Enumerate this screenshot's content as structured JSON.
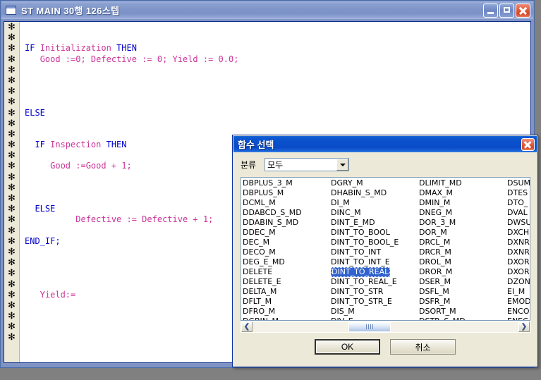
{
  "editor_window": {
    "title": "ST MAIN  30행 126스텝",
    "icon": "document-icon",
    "minimize_label": "",
    "maximize_label": "",
    "close_label": "",
    "gutter_mark": "✻",
    "gutter_rows": 30,
    "code_lines": [
      {
        "indent": 0,
        "tokens": []
      },
      {
        "indent": 0,
        "tokens": []
      },
      {
        "indent": 0,
        "tokens": [
          {
            "t": "IF ",
            "c": "kw"
          },
          {
            "t": "Initialization",
            "c": "idf"
          },
          {
            "t": " THEN",
            "c": "kw"
          }
        ]
      },
      {
        "indent": 0,
        "tokens": [
          {
            "t": "   ",
            "c": "idf"
          },
          {
            "t": "Good :=0; Defective := 0; Yield := 0.0;",
            "c": "idf"
          }
        ]
      },
      {
        "indent": 0,
        "tokens": []
      },
      {
        "indent": 0,
        "tokens": []
      },
      {
        "indent": 0,
        "tokens": []
      },
      {
        "indent": 0,
        "tokens": []
      },
      {
        "indent": 0,
        "tokens": [
          {
            "t": "ELSE",
            "c": "kw"
          }
        ]
      },
      {
        "indent": 0,
        "tokens": []
      },
      {
        "indent": 0,
        "tokens": []
      },
      {
        "indent": 0,
        "tokens": [
          {
            "t": "  IF ",
            "c": "kw"
          },
          {
            "t": "Inspection",
            "c": "idf"
          },
          {
            "t": " THEN",
            "c": "kw"
          }
        ]
      },
      {
        "indent": 0,
        "tokens": []
      },
      {
        "indent": 0,
        "tokens": [
          {
            "t": "     Good :=",
            "c": "idf"
          },
          {
            "t": "Good + 1;",
            "c": "idf"
          }
        ]
      },
      {
        "indent": 0,
        "tokens": []
      },
      {
        "indent": 0,
        "tokens": []
      },
      {
        "indent": 0,
        "tokens": []
      },
      {
        "indent": 0,
        "tokens": [
          {
            "t": "  ELSE",
            "c": "kw"
          }
        ]
      },
      {
        "indent": 0,
        "tokens": [
          {
            "t": "          Defective := Defective + 1;",
            "c": "idf"
          }
        ]
      },
      {
        "indent": 0,
        "tokens": []
      },
      {
        "indent": 0,
        "tokens": [
          {
            "t": "END_IF;",
            "c": "kw"
          }
        ]
      },
      {
        "indent": 0,
        "tokens": []
      },
      {
        "indent": 0,
        "tokens": []
      },
      {
        "indent": 0,
        "tokens": []
      },
      {
        "indent": 0,
        "tokens": []
      },
      {
        "indent": 0,
        "tokens": [
          {
            "t": "   Yield:=",
            "c": "idf"
          }
        ]
      },
      {
        "indent": 0,
        "tokens": []
      },
      {
        "indent": 0,
        "tokens": []
      },
      {
        "indent": 0,
        "tokens": []
      },
      {
        "indent": 0,
        "tokens": []
      }
    ]
  },
  "dialog": {
    "title": "함수 선택",
    "close_label": "",
    "category": {
      "label": "분류",
      "selected": "모두",
      "options": [
        "모두"
      ]
    },
    "list": {
      "selected": "DINT_TO_REAL",
      "columns": [
        [
          "DBPLUS_3_M",
          "DBPLUS_M",
          "DCML_M",
          "DDABCD_S_MD",
          "DDABIN_S_MD",
          "DDEC_M",
          "DEC_M",
          "DECO_M",
          "DEG_E_MD",
          "DELETE",
          "DELETE_E",
          "DELTA_M",
          "DFLT_M",
          "DFRO_M",
          "DGBIN_M"
        ],
        [
          "DGRY_M",
          "DHABIN_S_MD",
          "DI_M",
          "DINC_M",
          "DINT_E_MD",
          "DINT_TO_BOOL",
          "DINT_TO_BOOL_E",
          "DINT_TO_INT",
          "DINT_TO_INT_E",
          "DINT_TO_REAL",
          "DINT_TO_REAL_E",
          "DINT_TO_STR",
          "DINT_TO_STR_E",
          "DIS_M",
          "DIV_E"
        ],
        [
          "DLIMIT_MD",
          "DMAX_M",
          "DMIN_M",
          "DNEG_M",
          "DOR_3_M",
          "DOR_M",
          "DRCL_M",
          "DRCR_M",
          "DROL_M",
          "DROR_M",
          "DSER_M",
          "DSFL_M",
          "DSFR_M",
          "DSORT_M",
          "DSTR_S_MD"
        ],
        [
          "DSUM",
          "DTES",
          "DTO_",
          "DVAL",
          "DWSU",
          "DXCH",
          "DXNR",
          "DXNR",
          "DXOR",
          "DXOR",
          "DZON",
          "EI_M",
          "EMOD",
          "ENCO",
          "ENEG"
        ]
      ]
    },
    "scrollbar": {
      "left_arrow": "❮",
      "right_arrow": "❯"
    },
    "buttons": {
      "ok": "OK",
      "cancel": "취소"
    }
  },
  "colors": {
    "keyword": "#0000cc",
    "identifier": "#cc3399",
    "selection": "#3163ce",
    "dialog_bg": "#ece9d8",
    "dialog_title": "#0a4fcb",
    "desktop": "#808080"
  }
}
